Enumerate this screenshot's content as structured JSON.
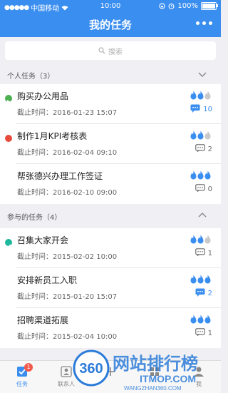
{
  "status_bar": {
    "carrier": "中国移动",
    "time": "10:00",
    "battery": "100%"
  },
  "nav": {
    "title": "我的任务"
  },
  "search": {
    "placeholder": "搜索"
  },
  "sections": [
    {
      "label": "个人任务（3）",
      "expanded": true
    },
    {
      "label": "参与的任务（4）",
      "expanded": false
    }
  ],
  "tasks": [
    {
      "title": "购买办公用品",
      "deadline": "截止时间：2016-01-23 15:07",
      "marker": "green-arrow",
      "priority": 2,
      "comments": "10",
      "comments_active": true
    },
    {
      "title": "制作1月KPI考核表",
      "deadline": "截止时间：2016-02-04 09:10",
      "marker": "red-dot",
      "priority": 2,
      "comments": "2",
      "comments_active": false
    },
    {
      "title": "帮张德兴办理工作签证",
      "deadline": "截止时间：2016-02-10 09:00",
      "marker": "none",
      "priority": 3,
      "comments": "0",
      "comments_active": false
    },
    {
      "title": "召集大家开会",
      "deadline": "截止时间：2015-02-02 10:00",
      "marker": "teal-check",
      "priority": 2,
      "comments": "1",
      "comments_active": false
    },
    {
      "title": "安排新员工入职",
      "deadline": "截止时间：2015-01-20 15:07",
      "marker": "none",
      "priority": 3,
      "comments": "2",
      "comments_active": true
    },
    {
      "title": "招聘渠道拓展",
      "deadline": "截止时间：2015-02-04 10:00",
      "marker": "none",
      "priority": 3,
      "comments": "1",
      "comments_active": false
    }
  ],
  "tabbar": {
    "items": [
      {
        "label": "任务",
        "badge": "1"
      },
      {
        "label": "联系人"
      },
      {
        "label": ""
      },
      {
        "label": ""
      },
      {
        "label": "我"
      }
    ]
  },
  "watermark": {
    "text": "网站排行榜",
    "number": "360",
    "url": "ITMOP.COM",
    "sub": "WANGZHAN360.COM"
  },
  "colors": {
    "accent": "#3a8ef0",
    "red": "#e84b3c",
    "green": "#4caf50",
    "teal": "#1db79b",
    "badge": "#f25a4d"
  }
}
